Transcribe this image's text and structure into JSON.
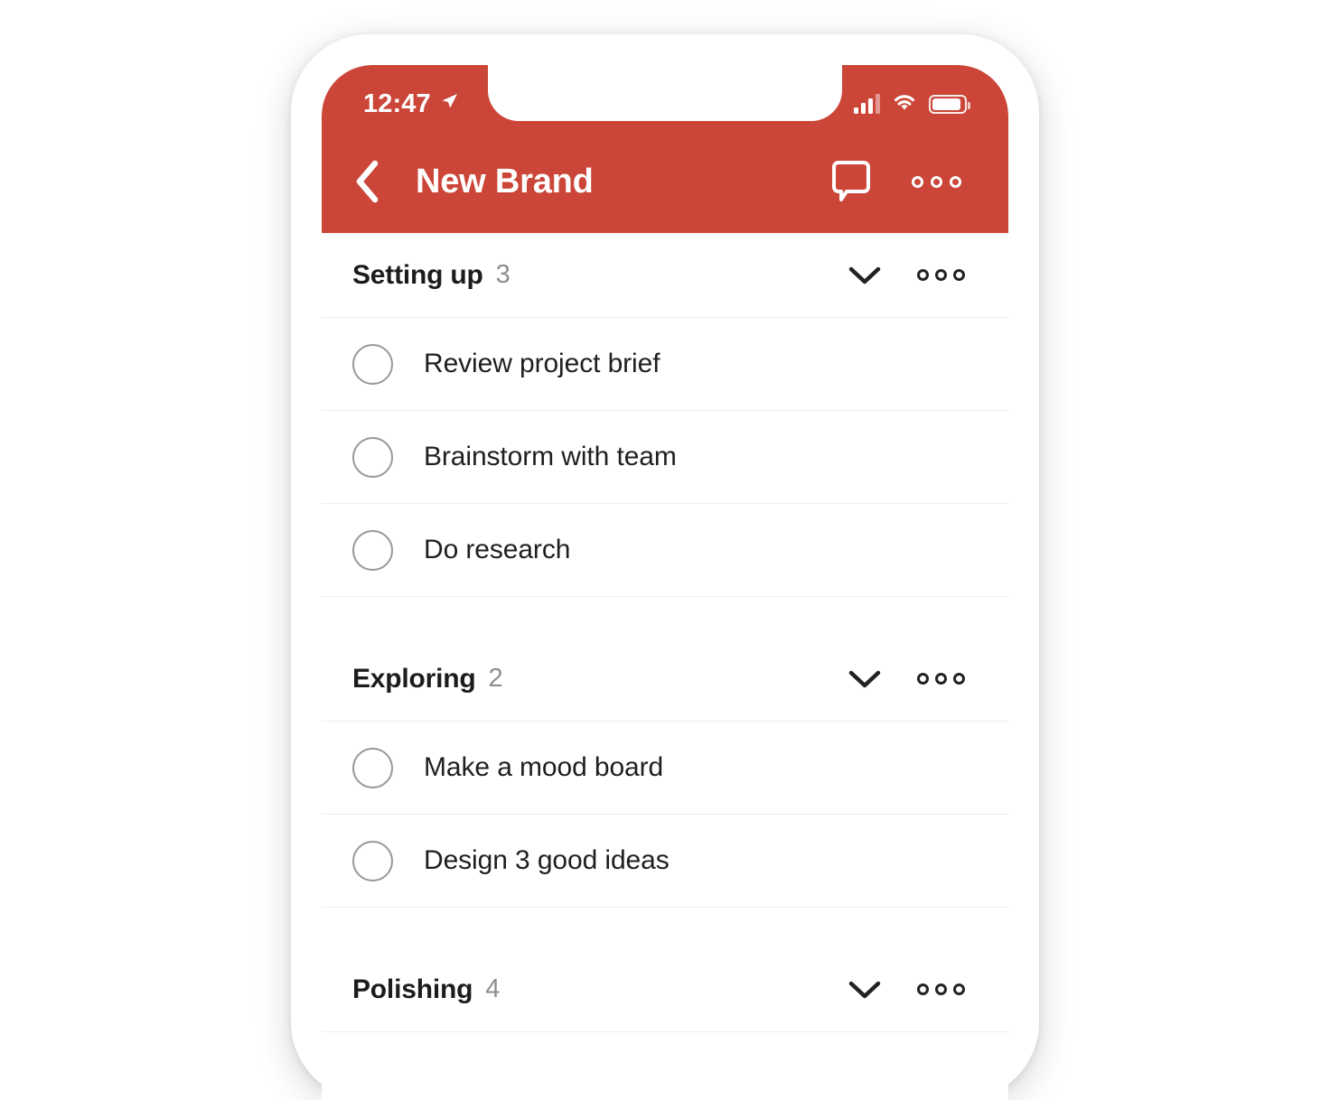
{
  "status_bar": {
    "time": "12:47",
    "location_icon": "location-arrow-icon",
    "signal_icon": "cellular-signal-icon",
    "wifi_icon": "wifi-icon",
    "battery_icon": "battery-icon"
  },
  "nav": {
    "back_icon": "chevron-left-icon",
    "title": "New Brand",
    "comment_icon": "comment-bubble-icon",
    "more_icon": "more-horizontal-icon"
  },
  "theme": {
    "accent": "#cb4638",
    "text": "#1f1f1f",
    "muted": "#8e8e8e",
    "divider": "#ededed",
    "checkbox_border": "#9a9a9a",
    "bezel": "#ffffff",
    "page_background": "#ffffff"
  },
  "sections": [
    {
      "title": "Setting up",
      "count": "3",
      "collapse_icon": "chevron-down-icon",
      "more_icon": "more-horizontal-icon",
      "tasks": [
        {
          "label": "Review project brief",
          "checked": false
        },
        {
          "label": "Brainstorm with team",
          "checked": false
        },
        {
          "label": "Do research",
          "checked": false
        }
      ]
    },
    {
      "title": "Exploring",
      "count": "2",
      "collapse_icon": "chevron-down-icon",
      "more_icon": "more-horizontal-icon",
      "tasks": [
        {
          "label": "Make a mood board",
          "checked": false
        },
        {
          "label": "Design 3 good ideas",
          "checked": false
        }
      ]
    },
    {
      "title": "Polishing",
      "count": "4",
      "collapse_icon": "chevron-down-icon",
      "more_icon": "more-horizontal-icon",
      "tasks": []
    }
  ]
}
